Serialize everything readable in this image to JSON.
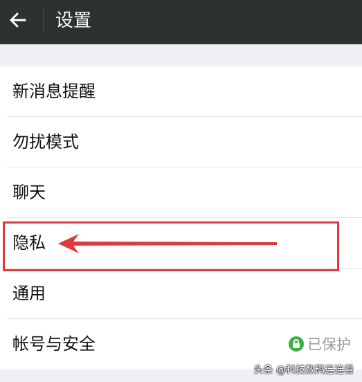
{
  "topbar": {
    "title": "设置",
    "back_icon": "arrow-left-icon"
  },
  "settings": {
    "items": [
      {
        "label": "新消息提醒"
      },
      {
        "label": "勿扰模式"
      },
      {
        "label": "聊天"
      },
      {
        "label": "隐私"
      },
      {
        "label": "通用"
      },
      {
        "label": "帐号与安全",
        "status": "已保护",
        "status_icon": "lock-icon"
      }
    ]
  },
  "annotation": {
    "highlight_color": "#e0393e"
  },
  "watermark": "头条 @科技数码连连看"
}
